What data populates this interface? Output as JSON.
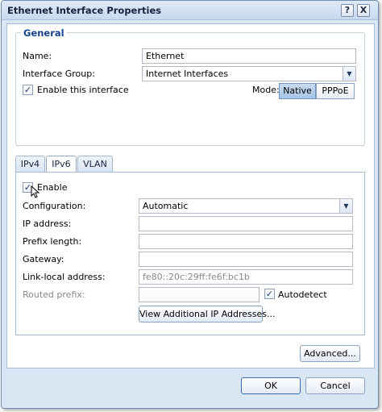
{
  "window": {
    "title": "Ethernet Interface Properties",
    "help_label": "?",
    "close_label": "X"
  },
  "general": {
    "legend": "General",
    "name_label": "Name:",
    "name_value": "Ethernet",
    "group_label": "Interface Group:",
    "group_value": "Internet Interfaces",
    "enable_label": "Enable this interface",
    "enable_checked": true,
    "mode_label": "Mode:",
    "mode_options": [
      "Native",
      "PPPoE"
    ],
    "mode_selected": "Native"
  },
  "tabs": [
    {
      "label": "IPv4"
    },
    {
      "label": "IPv6"
    },
    {
      "label": "VLAN"
    }
  ],
  "active_tab": "IPv6",
  "ipv6": {
    "enable_label": "Enable",
    "enable_checked": true,
    "config_label": "Configuration:",
    "config_value": "Automatic",
    "ip_label": "IP address:",
    "ip_value": "",
    "prefix_label": "Prefix length:",
    "prefix_value": "",
    "gateway_label": "Gateway:",
    "gateway_value": "",
    "linklocal_label": "Link-local address:",
    "linklocal_value": "fe80::20c:29ff:fe6f:bc1b",
    "routed_label": "Routed prefix:",
    "routed_value": "",
    "autodetect_label": "Autodetect",
    "autodetect_checked": true,
    "view_more_label": "View Additional IP Addresses..."
  },
  "buttons": {
    "advanced": "Advanced...",
    "ok": "OK",
    "cancel": "Cancel"
  },
  "colors": {
    "accent": "#15428b",
    "dialog_bg": "#d9e6f4"
  }
}
